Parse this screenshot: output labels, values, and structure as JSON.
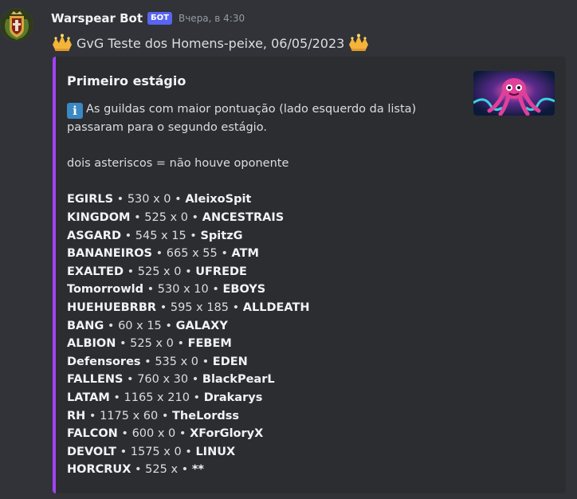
{
  "message": {
    "username": "Warspear Bot",
    "bot_badge": "БОТ",
    "timestamp": "Вчера, в 4:30",
    "content": "GvG Teste dos Homens-peixe, 06/05/2023",
    "avatar_icon": "shield-crest-icon",
    "content_icon": "crown-icon"
  },
  "embed": {
    "accent_color": "#a142f4",
    "title": "Primeiro estágio",
    "info_icon": "i",
    "intro_line1": "As guildas com maior pontuação (lado esquerdo da lista)",
    "intro_line2": "passaram para o segundo estágio.",
    "note": "dois asteriscos = não houve oponente",
    "thumbnail_icon": "octopus-art",
    "results": [
      {
        "left": "EGIRLS",
        "score": "• 530 x 0 •",
        "right": "AleixoSpit"
      },
      {
        "left": "KINGDOM",
        "score": "• 525 x 0 •",
        "right": "ANCESTRAIS"
      },
      {
        "left": "ASGARD",
        "score": "• 545 x 15 •",
        "right": "SpitzG"
      },
      {
        "left": "BANANEIROS",
        "score": "• 665 x 55 •",
        "right": "ATM"
      },
      {
        "left": "EXALTED",
        "score": "• 525 x 0 •",
        "right": "UFREDE"
      },
      {
        "left": "Tomorrowld",
        "score": "• 530 x 10 •",
        "right": "EBOYS"
      },
      {
        "left": "HUEHUEBRBR",
        "score": "• 595 x 185 •",
        "right": "ALLDEATH"
      },
      {
        "left": "BANG",
        "score": "• 60 x 15 •",
        "right": "GALAXY"
      },
      {
        "left": "ALBION",
        "score": "• 525 x 0 •",
        "right": "FEBEM"
      },
      {
        "left": "Defensores",
        "score": "• 535 x 0 •",
        "right": "EDEN"
      },
      {
        "left": "FALLENS",
        "score": "• 760 x 30 •",
        "right": "BlackPearL"
      },
      {
        "left": "LATAM",
        "score": "• 1165 x 210 •",
        "right": "Drakarys"
      },
      {
        "left": "RH",
        "score": "• 1175 x 60 •",
        "right": "TheLordss"
      },
      {
        "left": "FALCON",
        "score": "• 600 x 0 •",
        "right": "XForGloryX"
      },
      {
        "left": "DEVOLT",
        "score": "• 1575 x 0 •",
        "right": "LINUX"
      },
      {
        "left": "HORCRUX",
        "score": "• 525 x •",
        "right": "**"
      }
    ]
  }
}
